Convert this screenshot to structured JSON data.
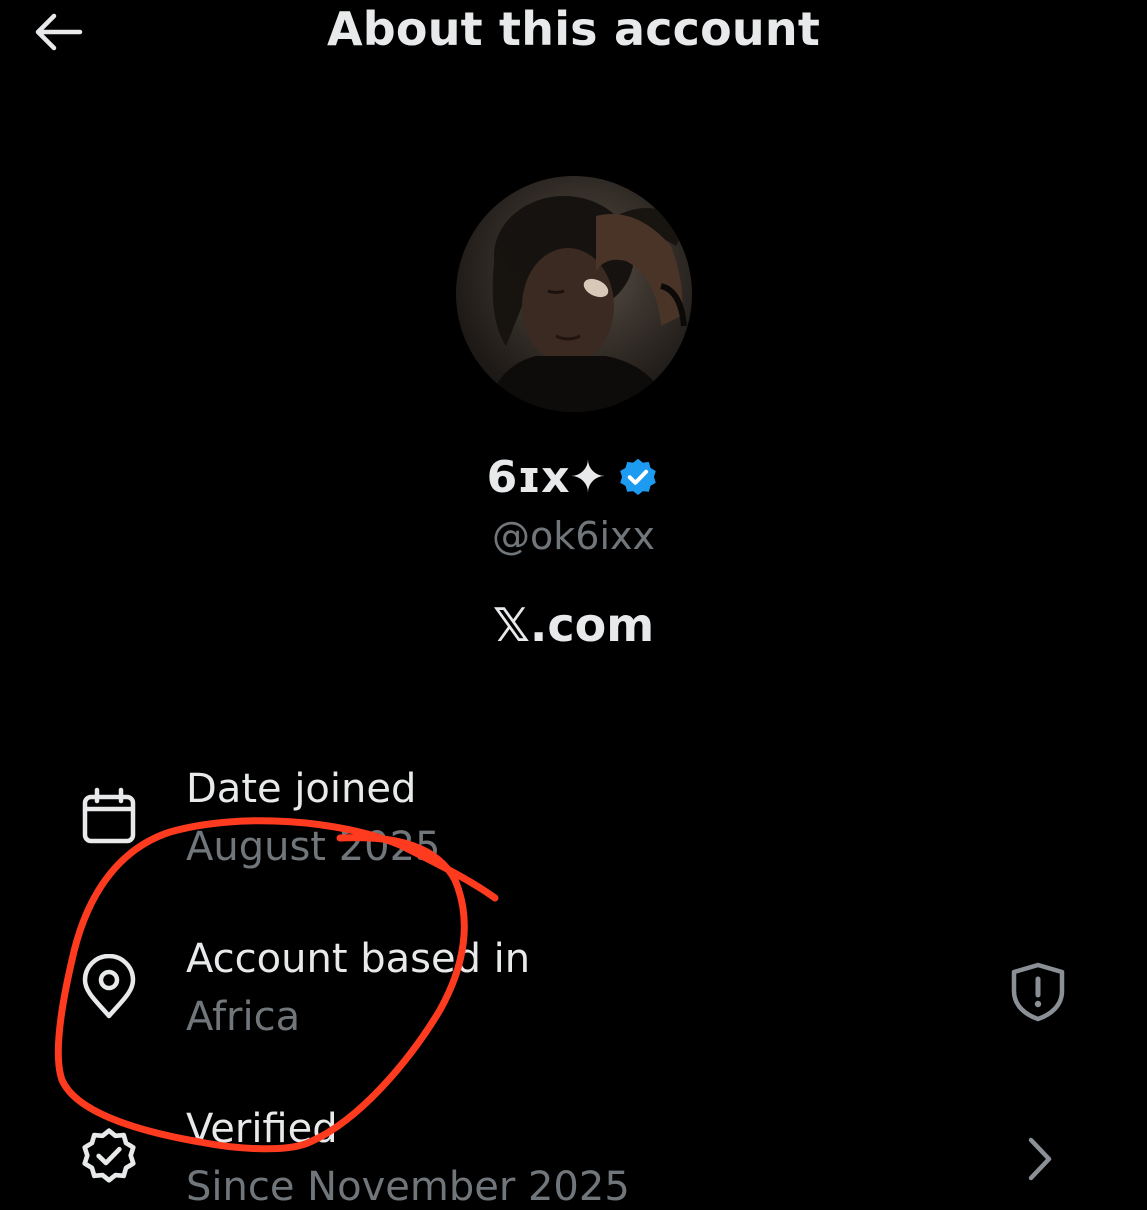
{
  "header": {
    "title": "About this account",
    "back_icon": "arrow-left-icon"
  },
  "profile": {
    "display_name": "6ɪx✦",
    "verified_icon": "verified-badge-icon",
    "verified_color": "#1d9bf0",
    "handle": "@ok6ixx",
    "platform": "𝕏.com"
  },
  "details": {
    "date_joined": {
      "icon": "calendar-icon",
      "label": "Date joined",
      "value": "August 2025"
    },
    "account_based_in": {
      "icon": "location-pin-icon",
      "label": "Account based in",
      "value": "Africa",
      "action_icon": "shield-alert-icon"
    },
    "verified": {
      "icon": "verified-check-icon",
      "label": "Verified",
      "value": "Since November 2025",
      "action_icon": "chevron-right-icon"
    }
  },
  "colors": {
    "background": "#000000",
    "primary_text": "#e7e9ea",
    "secondary_text": "#71767b",
    "annotation": "#ff3b1f"
  }
}
